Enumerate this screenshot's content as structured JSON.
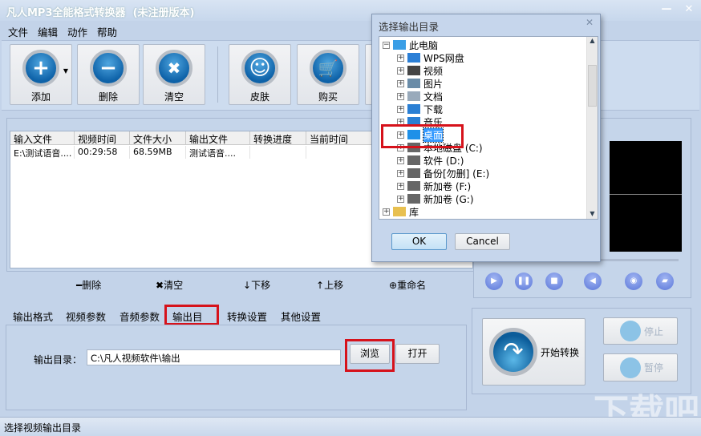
{
  "window": {
    "title": "凡人MP3全能格式转换器",
    "title_suffix": "(未注册版本)",
    "min": "—",
    "close": "✕"
  },
  "menu": [
    "文件",
    "编辑",
    "动作",
    "帮助"
  ],
  "toolbar": [
    {
      "label": "添加",
      "icon": "+"
    },
    {
      "label": "删除",
      "icon": "−"
    },
    {
      "label": "清空",
      "icon": "✖"
    },
    {
      "label": "皮肤",
      "icon": "☺"
    },
    {
      "label": "购买",
      "icon": "🛒"
    }
  ],
  "file_list": {
    "columns": [
      "输入文件",
      "视频时间",
      "文件大小",
      "输出文件",
      "转换进度",
      "当前时间"
    ],
    "rows": [
      [
        "E:\\测试语音....",
        "00:29:58",
        "68.59MB",
        "测试语音....",
        "",
        ""
      ]
    ]
  },
  "list_actions": [
    {
      "icon": "━",
      "label": "删除"
    },
    {
      "icon": "✖",
      "label": "清空"
    },
    {
      "icon": "↓",
      "label": "下移"
    },
    {
      "icon": "↑",
      "label": "上移"
    },
    {
      "icon": "⊕",
      "label": "重命名"
    }
  ],
  "tabs": [
    "输出格式",
    "视频参数",
    "音频参数",
    "输出目录",
    "转换设置",
    "其他设置"
  ],
  "active_tab": "输出目录",
  "output": {
    "label": "输出目录：",
    "value": "C:\\凡人视频软件\\输出",
    "browse": "浏览",
    "open": "打开"
  },
  "convert": {
    "start": "开始转换",
    "stop": "停止",
    "pause": "暂停"
  },
  "status": "选择视频输出目录",
  "dialog": {
    "title": "选择输出目录",
    "close": "✕",
    "ok": "OK",
    "cancel": "Cancel",
    "tree": [
      {
        "label": "此电脑",
        "icon": "computer",
        "level": 0,
        "pm": "−"
      },
      {
        "label": "WPS网盘",
        "icon": "cloud",
        "level": 1
      },
      {
        "label": "视频",
        "icon": "film",
        "level": 1
      },
      {
        "label": "图片",
        "icon": "picture",
        "level": 1
      },
      {
        "label": "文档",
        "icon": "document",
        "level": 1
      },
      {
        "label": "下载",
        "icon": "download",
        "level": 1
      },
      {
        "label": "音乐",
        "icon": "music",
        "level": 1
      },
      {
        "label": "桌面",
        "icon": "desktop",
        "level": 1,
        "selected": true
      },
      {
        "label": "本地磁盘 (C:)",
        "icon": "drive",
        "level": 1
      },
      {
        "label": "软件 (D:)",
        "icon": "drive",
        "level": 1
      },
      {
        "label": "备份[勿删] (E:)",
        "icon": "drive",
        "level": 1
      },
      {
        "label": "新加卷 (F:)",
        "icon": "drive",
        "level": 1
      },
      {
        "label": "新加卷 (G:)",
        "icon": "drive",
        "level": 1
      },
      {
        "label": "库",
        "icon": "library",
        "level": 0
      }
    ]
  },
  "watermark": "下载吧"
}
